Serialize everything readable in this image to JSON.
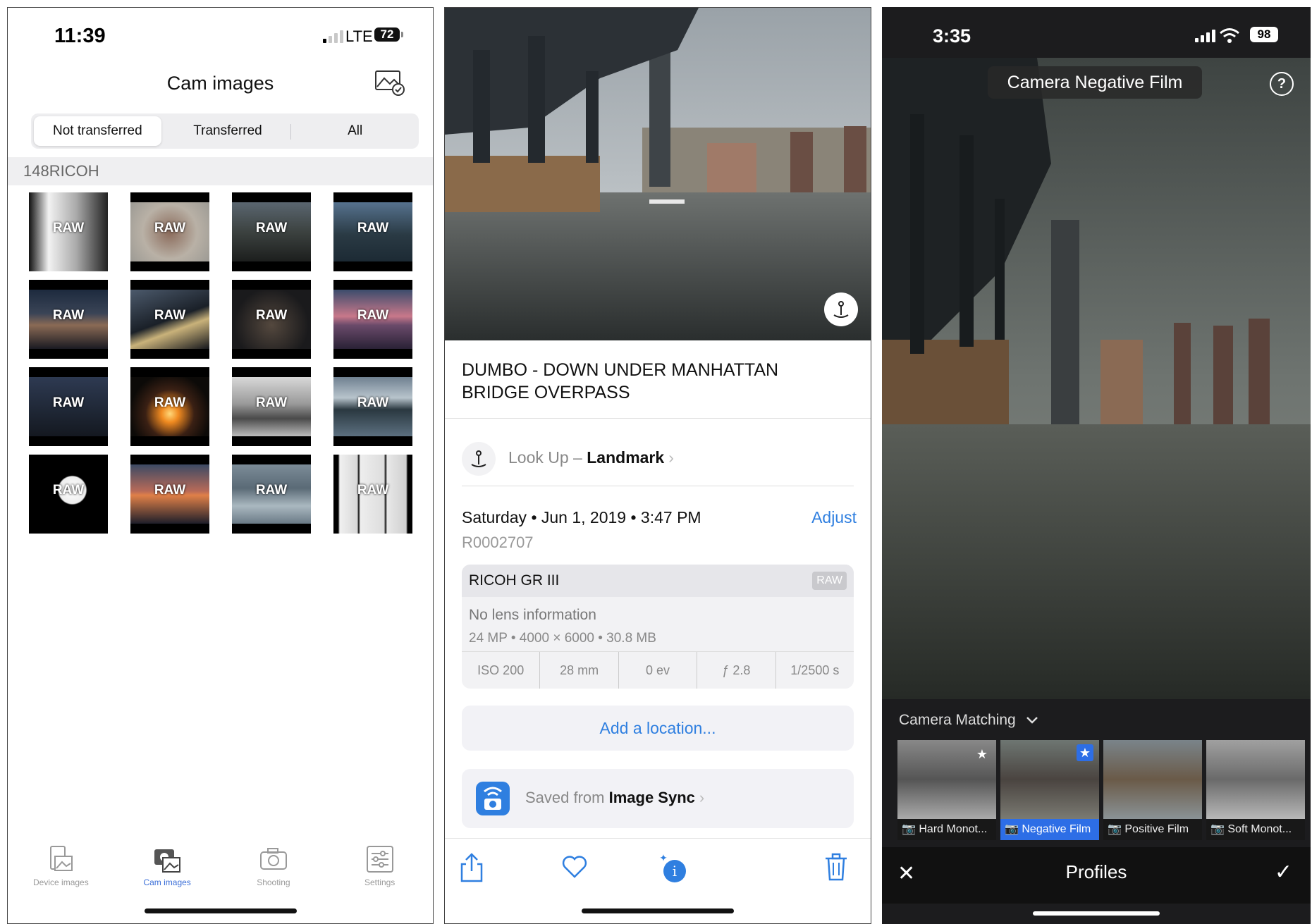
{
  "p1": {
    "status": {
      "time": "11:39",
      "network": "LTE",
      "battery": "72"
    },
    "title": "Cam images",
    "segments": [
      "Not transferred",
      "Transferred",
      "All"
    ],
    "folder": "148RICOH",
    "thumb_label": "RAW",
    "tabs": [
      "Device images",
      "Cam images",
      "Shooting",
      "Settings"
    ]
  },
  "p2": {
    "landmark_title": "DUMBO - DOWN UNDER MANHATTAN BRIDGE OVERPASS",
    "lookup_prefix": "Look Up – ",
    "lookup_value": "Landmark",
    "datetime": "Saturday • Jun 1, 2019 • 3:47 PM",
    "adjust": "Adjust",
    "filename": "R0002707",
    "camera": "RICOH GR III",
    "raw_badge": "RAW",
    "lens": "No lens information",
    "specs": "24 MP  •  4000 × 6000  •  30.8 MB",
    "exif": [
      "ISO 200",
      "28 mm",
      "0 ev",
      "ƒ 2.8",
      "1/2500 s"
    ],
    "add_location": "Add a location...",
    "saved_prefix": "Saved from ",
    "saved_app": "Image Sync"
  },
  "p3": {
    "status": {
      "time": "3:35",
      "battery": "98"
    },
    "profile_pill": "Camera Negative Film",
    "help": "?",
    "group": "Camera Matching",
    "profiles": [
      "Hard Monot...",
      "Negative Film",
      "Positive Film",
      "Soft Monot..."
    ],
    "bottom_title": "Profiles"
  },
  "colors": {
    "accent_blue": "#2f7fe0",
    "lr_blue": "#2d6ee6"
  }
}
